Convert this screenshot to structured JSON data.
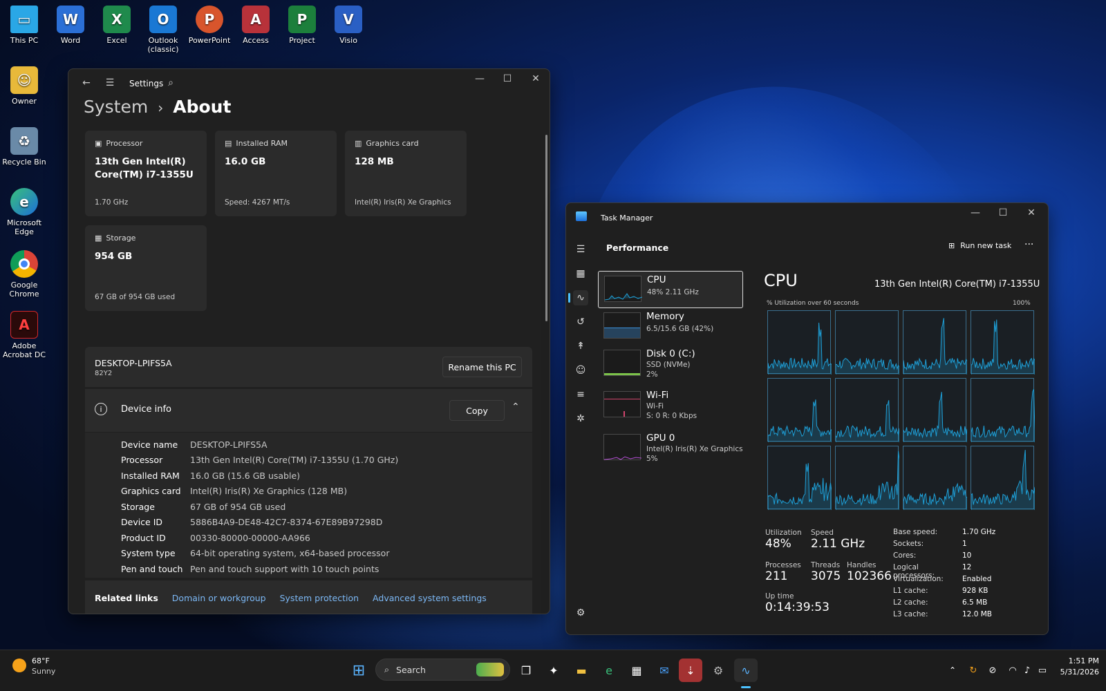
{
  "desktop": {
    "icons": [
      {
        "label": "This PC"
      },
      {
        "label": "Word"
      },
      {
        "label": "Excel"
      },
      {
        "label": "Outlook (classic)"
      },
      {
        "label": "PowerPoint"
      },
      {
        "label": "Access"
      },
      {
        "label": "Project"
      },
      {
        "label": "Visio"
      },
      {
        "label": "Owner"
      },
      {
        "label": "Recycle Bin"
      },
      {
        "label": "Microsoft Edge"
      },
      {
        "label": "Google Chrome"
      },
      {
        "label": "Adobe Acrobat DC"
      }
    ]
  },
  "settings": {
    "app_title": "Settings",
    "breadcrumb_parent": "System",
    "breadcrumb_sep": "›",
    "breadcrumb_current": "About",
    "cards": [
      {
        "label": "Processor",
        "value": "13th Gen Intel(R) Core(TM) i7-1355U",
        "sub": "1.70 GHz"
      },
      {
        "label": "Installed RAM",
        "value": "16.0 GB",
        "sub": "Speed: 4267 MT/s"
      },
      {
        "label": "Graphics card",
        "value": "128 MB",
        "sub": "Intel(R) Iris(R) Xe Graphics"
      },
      {
        "label": "Storage",
        "value": "954 GB",
        "sub": "67 GB of 954 GB used"
      }
    ],
    "pc_name": "DESKTOP-LPIFS5A",
    "pc_model": "82Y2",
    "rename_label": "Rename this PC",
    "device_info_title": "Device info",
    "copy_label": "Copy",
    "specs": [
      {
        "key": "Device name",
        "value": "DESKTOP-LPIFS5A"
      },
      {
        "key": "Processor",
        "value": "13th Gen Intel(R) Core(TM) i7-1355U (1.70 GHz)"
      },
      {
        "key": "Installed RAM",
        "value": "16.0 GB (15.6 GB usable)"
      },
      {
        "key": "Graphics card",
        "value": "Intel(R) Iris(R) Xe Graphics (128 MB)"
      },
      {
        "key": "Storage",
        "value": "67 GB of 954 GB used"
      },
      {
        "key": "Device ID",
        "value": "5886B4A9-DE48-42C7-8374-67E89B97298D"
      },
      {
        "key": "Product ID",
        "value": "00330-80000-00000-AA966"
      },
      {
        "key": "System type",
        "value": "64-bit operating system, x64-based processor"
      },
      {
        "key": "Pen and touch",
        "value": "Pen and touch support with 10 touch points"
      }
    ],
    "related_links_label": "Related links",
    "related_links": [
      "Domain or workgroup",
      "System protection",
      "Advanced system settings"
    ]
  },
  "taskmgr": {
    "title": "Task Manager",
    "section": "Performance",
    "run_new_task": "Run new task",
    "more": "···",
    "items": [
      {
        "name": "CPU",
        "sub1": "48% 2.11 GHz",
        "sub2": "",
        "sub3": ""
      },
      {
        "name": "Memory",
        "sub1": "6.5/15.6 GB (42%)",
        "sub2": "",
        "sub3": ""
      },
      {
        "name": "Disk 0 (C:)",
        "sub1": "SSD (NVMe)",
        "sub2": "2%",
        "sub3": ""
      },
      {
        "name": "Wi-Fi",
        "sub1": "Wi-Fi",
        "sub2": "S: 0 R: 0 Kbps",
        "sub3": ""
      },
      {
        "name": "GPU 0",
        "sub1": "Intel(R) Iris(R) Xe Graphics",
        "sub2": "5%",
        "sub3": ""
      }
    ],
    "cpu_title": "CPU",
    "cpu_model": "13th Gen Intel(R) Core(TM) i7-1355U",
    "graph_label": "% Utilization over 60 seconds",
    "graph_max": "100%",
    "stats": {
      "utilization_label": "Utilization",
      "utilization": "48%",
      "speed_label": "Speed",
      "speed": "2.11 GHz",
      "processes_label": "Processes",
      "processes": "211",
      "threads_label": "Threads",
      "threads": "3075",
      "handles_label": "Handles",
      "handles": "102366",
      "uptime_label": "Up time",
      "uptime": "0:14:39:53"
    },
    "specs": [
      {
        "key": "Base speed:",
        "value": "1.70 GHz"
      },
      {
        "key": "Sockets:",
        "value": "1"
      },
      {
        "key": "Cores:",
        "value": "10"
      },
      {
        "key": "Logical processors:",
        "value": "12"
      },
      {
        "key": "Virtualization:",
        "value": "Enabled"
      },
      {
        "key": "L1 cache:",
        "value": "928 KB"
      },
      {
        "key": "L2 cache:",
        "value": "6.5 MB"
      },
      {
        "key": "L3 cache:",
        "value": "12.0 MB"
      }
    ]
  },
  "taskbar": {
    "weather_temp": "68°F",
    "weather_desc": "Sunny",
    "search_label": "Search",
    "time": "1:51 PM",
    "date": "5/31/2026"
  },
  "colors": {
    "accent": "#4cc2ff",
    "cpu_graph": "#1ea0d8",
    "memory_graph": "#3b8fd9",
    "disk_graph": "#7cc24a",
    "wifi_graph": "#d4456e",
    "gpu_graph": "#b44ed4"
  }
}
